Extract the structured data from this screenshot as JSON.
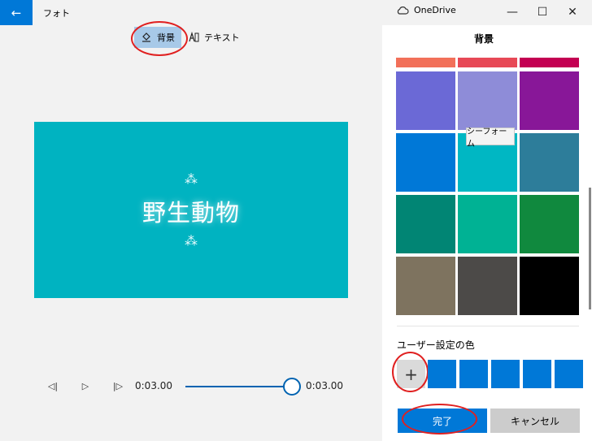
{
  "app": {
    "title": "フォト",
    "back_icon": "arrow-left-icon",
    "onedrive_label": "OneDrive",
    "window_controls": [
      "minimize",
      "maximize",
      "close"
    ]
  },
  "toolbar": {
    "background_label": "背景",
    "text_label": "テキスト"
  },
  "preview": {
    "title": "野生動物",
    "background_color": "#00b3c1"
  },
  "playback": {
    "current_time": "0:03.00",
    "end_time": "0:03.00",
    "progress": 1.0
  },
  "panel": {
    "title": "背景",
    "colors": [
      [
        "#f27059",
        "#e74856",
        "#c30052"
      ],
      [
        "#6b69d6",
        "#8e8cd8",
        "#881798"
      ],
      [
        "#0078d7",
        "#00b7c3",
        "#2d7d9a"
      ],
      [
        "#018574",
        "#00b294",
        "#10893e"
      ],
      [
        "#7e735f",
        "#4c4a48",
        "#000000"
      ]
    ],
    "tooltip": "シーフォーム",
    "custom_label": "ユーザー設定の色",
    "add_symbol": "+",
    "custom_colors": [
      "#0078d7",
      "#0078d7",
      "#0078d7",
      "#0078d7",
      "#0078d7"
    ],
    "done_label": "完了",
    "cancel_label": "キャンセル"
  }
}
